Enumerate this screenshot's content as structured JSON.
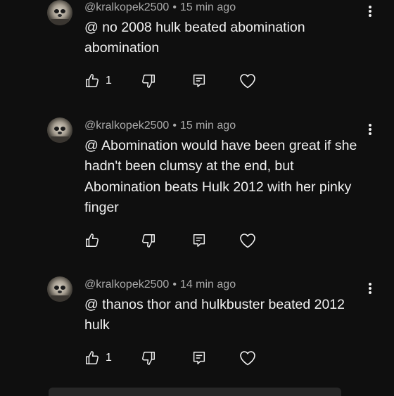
{
  "comments": [
    {
      "handle": "@kralkopek2500",
      "separator": "•",
      "time": "15 min ago",
      "text": "@ no 2008 hulk beated abomination abomination",
      "likes": "1"
    },
    {
      "handle": "@kralkopek2500",
      "separator": "•",
      "time": "15 min ago",
      "text": "@ Abomination would have been great if she hadn't been clumsy at the end, but Abomination beats Hulk 2012 with her pinky finger",
      "likes": ""
    },
    {
      "handle": "@kralkopek2500",
      "separator": "•",
      "time": "14 min ago",
      "text": "@ thanos thor and hulkbuster beated 2012 hulk",
      "likes": "1"
    }
  ],
  "icons": {
    "like": "thumbs-up-icon",
    "dislike": "thumbs-down-icon",
    "reply": "reply-icon",
    "heart": "heart-icon",
    "more": "more-vertical-icon"
  },
  "colors": {
    "background": "#0f0f0f",
    "text": "#f1f1f1",
    "meta": "#aaaaaa"
  }
}
